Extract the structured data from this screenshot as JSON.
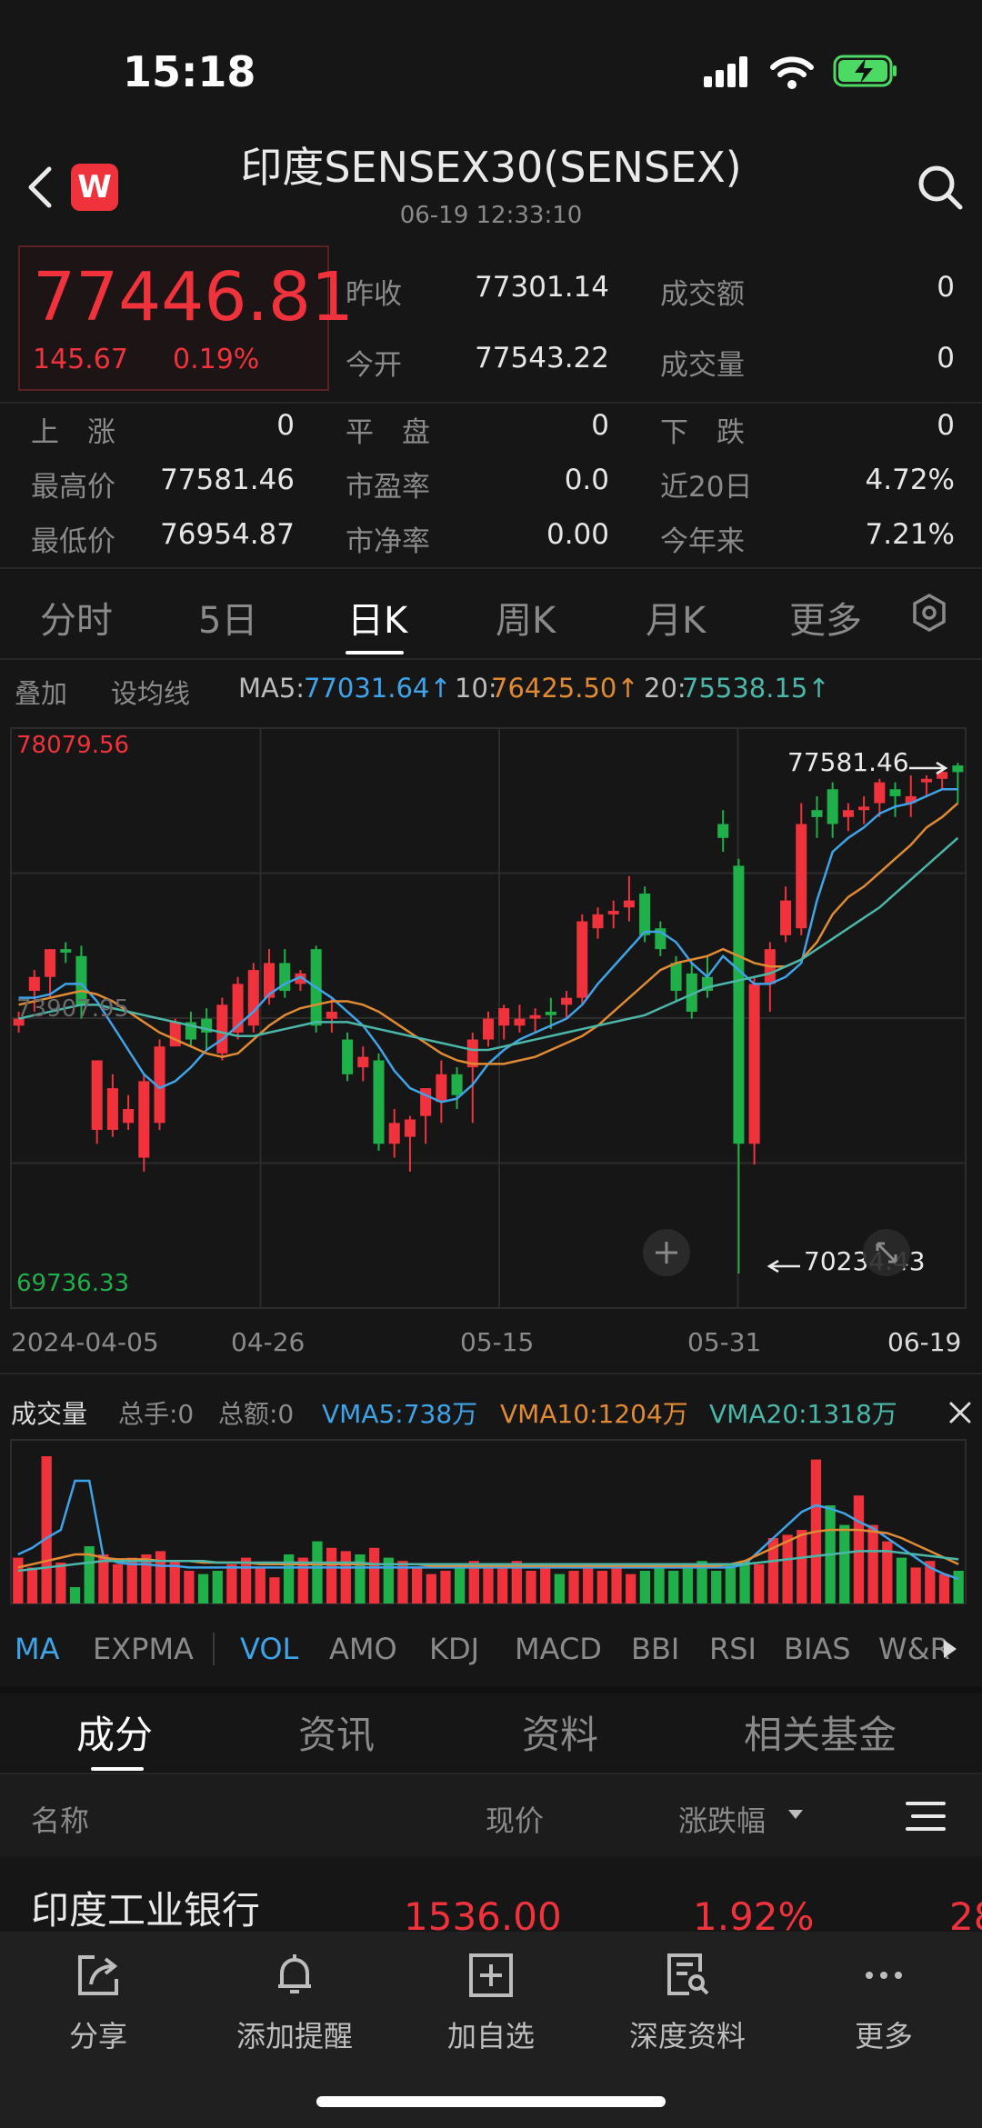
{
  "status": {
    "time": "15:18"
  },
  "header": {
    "title": "印度SENSEX30(SENSEX)",
    "timestamp": "06-19 12:33:10",
    "logo_text": "W"
  },
  "quote": {
    "price": "77446.81",
    "change": "145.67",
    "change_pct": "0.19%",
    "prev_close_label": "昨收",
    "prev_close": "77301.14",
    "turnover_label": "成交额",
    "turnover": "0",
    "open_label": "今开",
    "open": "77543.22",
    "volume_label": "成交量",
    "volume": "0",
    "up_label": "上　涨",
    "up": "0",
    "flat_label": "平　盘",
    "flat": "0",
    "down_label": "下　跌",
    "down": "0",
    "high_label": "最高价",
    "high": "77581.46",
    "pe_label": "市盈率",
    "pe": "0.0",
    "d20_label": "近20日",
    "d20": "4.72%",
    "low_label": "最低价",
    "low": "76954.87",
    "pb_label": "市净率",
    "pb": "0.00",
    "ytd_label": "今年来",
    "ytd": "7.21%"
  },
  "period_tabs": [
    "分时",
    "5日",
    "日K",
    "周K",
    "月K",
    "更多"
  ],
  "active_period": 2,
  "ma_row": {
    "overlay": "叠加",
    "set_ma": "设均线",
    "ma5_label": "MA5:",
    "ma5": "77031.64↑",
    "ma10_label": "10:",
    "ma10": "76425.50↑",
    "ma20_label": "20:",
    "ma20": "75538.15↑"
  },
  "colors": {
    "up": "#f0323c",
    "down": "#1fb04a",
    "ma5": "#3fa3e8",
    "ma10": "#e08a33",
    "ma20": "#4bb7a8"
  },
  "chart_data": {
    "type": "candlestick",
    "y_top_label": "78079.56",
    "y_mid_label": "73907.95",
    "y_bottom_label": "69736.33",
    "ylim": [
      69736.33,
      78079.56
    ],
    "max_marker": "77581.46",
    "min_marker": "70234.43",
    "x_tick_labels": [
      "2024-04-05",
      "04-26",
      "05-15",
      "05-31",
      "06-19"
    ],
    "grid": true,
    "candles": [
      {
        "o": 73800,
        "h": 74000,
        "l": 73700,
        "c": 73900
      },
      {
        "o": 74300,
        "h": 74600,
        "l": 74000,
        "c": 74500
      },
      {
        "o": 74500,
        "h": 74900,
        "l": 74200,
        "c": 74900
      },
      {
        "o": 74900,
        "h": 75000,
        "l": 74700,
        "c": 74850
      },
      {
        "o": 74800,
        "h": 74950,
        "l": 73900,
        "c": 74100
      },
      {
        "o": 72300,
        "h": 73300,
        "l": 72100,
        "c": 73300
      },
      {
        "o": 72300,
        "h": 73100,
        "l": 72200,
        "c": 72900
      },
      {
        "o": 72400,
        "h": 72800,
        "l": 72300,
        "c": 72600
      },
      {
        "o": 71900,
        "h": 73100,
        "l": 71700,
        "c": 73000
      },
      {
        "o": 72400,
        "h": 73600,
        "l": 72300,
        "c": 73500
      },
      {
        "o": 73500,
        "h": 73900,
        "l": 73500,
        "c": 73850
      },
      {
        "o": 73850,
        "h": 74000,
        "l": 73500,
        "c": 73600
      },
      {
        "o": 73900,
        "h": 74050,
        "l": 73450,
        "c": 73700
      },
      {
        "o": 73400,
        "h": 74200,
        "l": 73300,
        "c": 74100
      },
      {
        "o": 73700,
        "h": 74500,
        "l": 73600,
        "c": 74400
      },
      {
        "o": 73800,
        "h": 74700,
        "l": 73700,
        "c": 74600
      },
      {
        "o": 74200,
        "h": 74900,
        "l": 74100,
        "c": 74700
      },
      {
        "o": 74700,
        "h": 74900,
        "l": 74200,
        "c": 74300
      },
      {
        "o": 74400,
        "h": 74600,
        "l": 74300,
        "c": 74550
      },
      {
        "o": 74900,
        "h": 74950,
        "l": 73700,
        "c": 73800
      },
      {
        "o": 73900,
        "h": 74200,
        "l": 73700,
        "c": 74000
      },
      {
        "o": 73600,
        "h": 73700,
        "l": 73000,
        "c": 73100
      },
      {
        "o": 73200,
        "h": 73500,
        "l": 73000,
        "c": 73350
      },
      {
        "o": 73300,
        "h": 73400,
        "l": 72000,
        "c": 72100
      },
      {
        "o": 72100,
        "h": 72600,
        "l": 71900,
        "c": 72400
      },
      {
        "o": 72200,
        "h": 72500,
        "l": 71700,
        "c": 72450
      },
      {
        "o": 72500,
        "h": 72800,
        "l": 72100,
        "c": 72900
      },
      {
        "o": 72700,
        "h": 73300,
        "l": 72400,
        "c": 73100
      },
      {
        "o": 73100,
        "h": 73200,
        "l": 72600,
        "c": 72800
      },
      {
        "o": 73200,
        "h": 73700,
        "l": 72400,
        "c": 73600
      },
      {
        "o": 73600,
        "h": 74000,
        "l": 73500,
        "c": 73900
      },
      {
        "o": 73800,
        "h": 74100,
        "l": 73600,
        "c": 74050
      },
      {
        "o": 73800,
        "h": 74100,
        "l": 73700,
        "c": 73900
      },
      {
        "o": 73900,
        "h": 74050,
        "l": 73700,
        "c": 73950
      },
      {
        "o": 74000,
        "h": 74200,
        "l": 73750,
        "c": 73950
      },
      {
        "o": 74100,
        "h": 74300,
        "l": 73900,
        "c": 74200
      },
      {
        "o": 74200,
        "h": 75400,
        "l": 74100,
        "c": 75300
      },
      {
        "o": 75200,
        "h": 75500,
        "l": 75050,
        "c": 75400
      },
      {
        "o": 75400,
        "h": 75600,
        "l": 75200,
        "c": 75450
      },
      {
        "o": 75500,
        "h": 75950,
        "l": 75300,
        "c": 75600
      },
      {
        "o": 75700,
        "h": 75800,
        "l": 75000,
        "c": 75100
      },
      {
        "o": 75200,
        "h": 75300,
        "l": 74800,
        "c": 74900
      },
      {
        "o": 74700,
        "h": 74800,
        "l": 74150,
        "c": 74300
      },
      {
        "o": 74550,
        "h": 74700,
        "l": 73900,
        "c": 74000
      },
      {
        "o": 74500,
        "h": 74800,
        "l": 74200,
        "c": 74300
      },
      {
        "o": 76700,
        "h": 76900,
        "l": 76300,
        "c": 76500
      },
      {
        "o": 76100,
        "h": 76200,
        "l": 70234,
        "c": 72100
      },
      {
        "o": 72100,
        "h": 74500,
        "l": 71800,
        "c": 74400
      },
      {
        "o": 74400,
        "h": 75000,
        "l": 74000,
        "c": 74900
      },
      {
        "o": 75100,
        "h": 75800,
        "l": 75000,
        "c": 75600
      },
      {
        "o": 75200,
        "h": 77000,
        "l": 75100,
        "c": 76700
      },
      {
        "o": 76900,
        "h": 77100,
        "l": 76500,
        "c": 76800
      },
      {
        "o": 77200,
        "h": 77300,
        "l": 76500,
        "c": 76700
      },
      {
        "o": 76800,
        "h": 77000,
        "l": 76600,
        "c": 76900
      },
      {
        "o": 76900,
        "h": 77100,
        "l": 76700,
        "c": 76950
      },
      {
        "o": 77000,
        "h": 77350,
        "l": 76800,
        "c": 77300
      },
      {
        "o": 77200,
        "h": 77300,
        "l": 76800,
        "c": 77100
      },
      {
        "o": 77000,
        "h": 77400,
        "l": 76800,
        "c": 77100
      },
      {
        "o": 77300,
        "h": 77400,
        "l": 77100,
        "c": 77350
      },
      {
        "o": 77350,
        "h": 77500,
        "l": 77200,
        "c": 77450
      },
      {
        "o": 77543,
        "h": 77581,
        "l": 77000,
        "c": 77447
      }
    ],
    "ma5": [
      74200,
      74200,
      74250,
      74400,
      74400,
      74150,
      73800,
      73450,
      73100,
      72900,
      73000,
      73200,
      73450,
      73600,
      73800,
      74000,
      74250,
      74400,
      74500,
      74350,
      74200,
      74000,
      73800,
      73500,
      73150,
      72900,
      72800,
      72700,
      72750,
      72950,
      73250,
      73450,
      73600,
      73700,
      73800,
      73900,
      74100,
      74400,
      74650,
      74900,
      75150,
      75150,
      75000,
      74700,
      74500,
      74800,
      74600,
      74400,
      74400,
      74500,
      74700,
      75600,
      76300,
      76500,
      76650,
      76850,
      76950,
      77000,
      77100,
      77200,
      77200
    ],
    "ma10": [
      74100,
      74150,
      74200,
      74250,
      74300,
      74250,
      74150,
      74000,
      73850,
      73700,
      73600,
      73500,
      73400,
      73350,
      73400,
      73600,
      73800,
      73950,
      74050,
      74100,
      74150,
      74150,
      74100,
      74000,
      73850,
      73700,
      73550,
      73400,
      73300,
      73250,
      73250,
      73250,
      73300,
      73350,
      73450,
      73550,
      73650,
      73800,
      74000,
      74200,
      74400,
      74600,
      74700,
      74750,
      74800,
      74900,
      74800,
      74700,
      74650,
      74650,
      74750,
      75000,
      75400,
      75650,
      75800,
      76000,
      76200,
      76400,
      76650,
      76800,
      77000
    ],
    "ma20": [
      73900,
      73950,
      74000,
      74050,
      74100,
      74100,
      74050,
      74000,
      73950,
      73900,
      73850,
      73800,
      73750,
      73700,
      73650,
      73650,
      73700,
      73750,
      73800,
      73850,
      73850,
      73850,
      73800,
      73750,
      73700,
      73650,
      73600,
      73550,
      73500,
      73450,
      73450,
      73500,
      73550,
      73600,
      73650,
      73700,
      73750,
      73800,
      73850,
      73900,
      73950,
      74050,
      74150,
      74250,
      74350,
      74400,
      74450,
      74500,
      74550,
      74650,
      74750,
      74900,
      75050,
      75200,
      75350,
      75500,
      75700,
      75900,
      76100,
      76300,
      76500
    ]
  },
  "volume": {
    "title": "成交量",
    "total_hands": "总手:0",
    "total_amount": "总额:0",
    "vma5": "VMA5:738万",
    "vma10": "VMA10:1204万",
    "vma20": "VMA20:1318万",
    "bars": [
      0.28,
      0.22,
      0.9,
      0.25,
      0.1,
      0.35,
      0.3,
      0.24,
      0.28,
      0.3,
      0.32,
      0.26,
      0.2,
      0.18,
      0.2,
      0.24,
      0.28,
      0.22,
      0.16,
      0.3,
      0.28,
      0.38,
      0.34,
      0.32,
      0.3,
      0.34,
      0.28,
      0.26,
      0.22,
      0.18,
      0.2,
      0.24,
      0.26,
      0.22,
      0.24,
      0.26,
      0.2,
      0.22,
      0.18,
      0.2,
      0.24,
      0.2,
      0.22,
      0.18,
      0.2,
      0.24,
      0.2,
      0.22,
      0.26,
      0.2,
      0.24,
      0.26,
      0.24,
      0.4,
      0.42,
      0.45,
      0.88,
      0.6,
      0.48,
      0.66,
      0.48,
      0.38,
      0.28,
      0.22,
      0.26,
      0.18,
      0.2
    ],
    "vma5_line": [
      0.3,
      0.34,
      0.4,
      0.45,
      0.75,
      0.75,
      0.28,
      0.25,
      0.24,
      0.24,
      0.23,
      0.23,
      0.22,
      0.22,
      0.22,
      0.22,
      0.22,
      0.22,
      0.22,
      0.22,
      0.22,
      0.22,
      0.22,
      0.22,
      0.22,
      0.22,
      0.22,
      0.22,
      0.22,
      0.22,
      0.22,
      0.22,
      0.22,
      0.22,
      0.22,
      0.22,
      0.22,
      0.22,
      0.22,
      0.22,
      0.22,
      0.22,
      0.22,
      0.22,
      0.22,
      0.22,
      0.22,
      0.22,
      0.22,
      0.22,
      0.22,
      0.24,
      0.32,
      0.4,
      0.48,
      0.56,
      0.6,
      0.58,
      0.55,
      0.5,
      0.46,
      0.4,
      0.34,
      0.28,
      0.22,
      0.18,
      0.15
    ],
    "vma10_line": [
      0.22,
      0.24,
      0.26,
      0.28,
      0.3,
      0.3,
      0.28,
      0.27,
      0.27,
      0.27,
      0.26,
      0.26,
      0.26,
      0.25,
      0.25,
      0.25,
      0.25,
      0.24,
      0.24,
      0.24,
      0.24,
      0.24,
      0.24,
      0.24,
      0.24,
      0.24,
      0.24,
      0.24,
      0.24,
      0.23,
      0.23,
      0.23,
      0.23,
      0.23,
      0.23,
      0.23,
      0.23,
      0.23,
      0.23,
      0.23,
      0.23,
      0.23,
      0.23,
      0.23,
      0.23,
      0.23,
      0.23,
      0.23,
      0.23,
      0.23,
      0.24,
      0.26,
      0.3,
      0.34,
      0.38,
      0.42,
      0.44,
      0.45,
      0.45,
      0.45,
      0.44,
      0.43,
      0.4,
      0.36,
      0.32,
      0.28,
      0.24
    ],
    "vma20_line": [
      0.2,
      0.21,
      0.22,
      0.23,
      0.24,
      0.25,
      0.26,
      0.26,
      0.26,
      0.26,
      0.26,
      0.26,
      0.26,
      0.26,
      0.25,
      0.25,
      0.25,
      0.25,
      0.25,
      0.25,
      0.25,
      0.25,
      0.25,
      0.25,
      0.25,
      0.24,
      0.24,
      0.24,
      0.24,
      0.24,
      0.24,
      0.24,
      0.24,
      0.24,
      0.24,
      0.24,
      0.24,
      0.24,
      0.24,
      0.24,
      0.24,
      0.24,
      0.24,
      0.24,
      0.24,
      0.24,
      0.24,
      0.24,
      0.24,
      0.24,
      0.24,
      0.24,
      0.25,
      0.26,
      0.27,
      0.28,
      0.29,
      0.3,
      0.31,
      0.32,
      0.32,
      0.32,
      0.31,
      0.3,
      0.29,
      0.28,
      0.27
    ]
  },
  "indicator_tabs": [
    "MA",
    "EXPMA",
    "VOL",
    "AMO",
    "KDJ",
    "MACD",
    "BBI",
    "RSI",
    "BIAS",
    "W&R"
  ],
  "sub_tabs": [
    "成分",
    "资讯",
    "资料",
    "相关基金"
  ],
  "list_header": {
    "name": "名称",
    "price": "现价",
    "change": "涨跌幅"
  },
  "first_row": {
    "name": "印度工业银行",
    "price": "1536.00",
    "change": "1.92%",
    "extra": "28"
  },
  "bottom_bar": [
    "分享",
    "添加提醒",
    "加自选",
    "深度资料",
    "更多"
  ]
}
